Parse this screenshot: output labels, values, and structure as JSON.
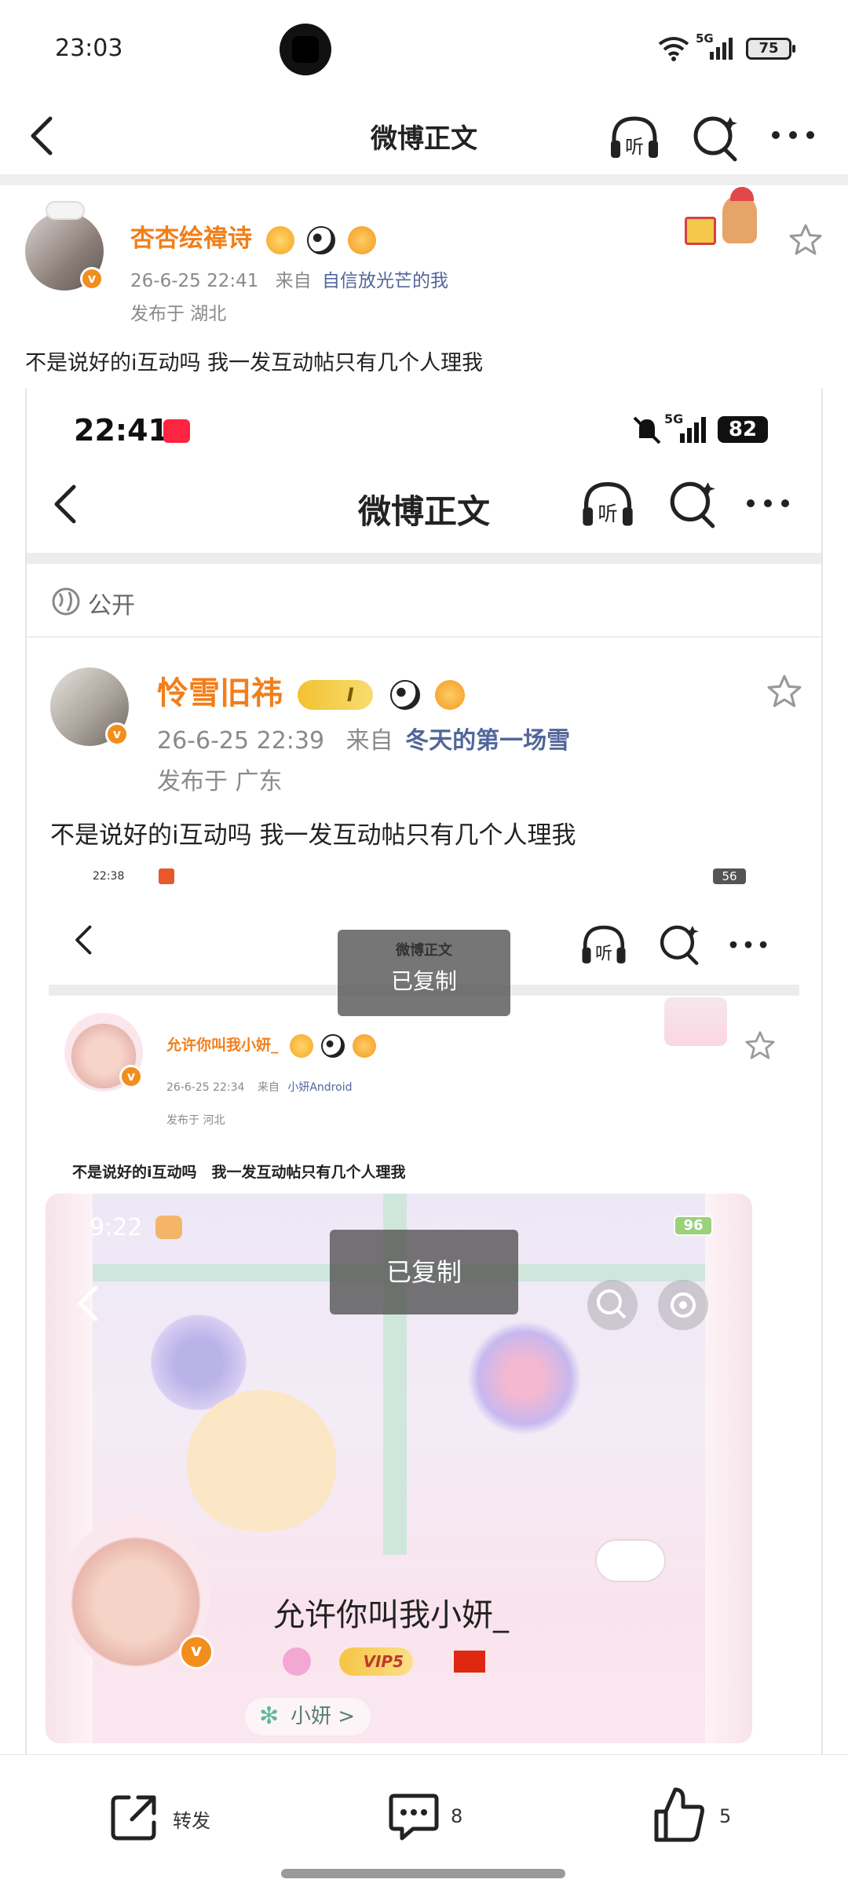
{
  "status_bar": {
    "time": "23:03",
    "battery": "75",
    "network": "5G"
  },
  "nav": {
    "title": "微博正文"
  },
  "post": {
    "author": "杏杏绘禕诗",
    "datetime": "26-6-25 22:41",
    "from_label": "来自",
    "source": "自信放光芒的我",
    "location": "发布于 湖北",
    "text": "不是说好的i互动吗 我一发互动帖只有几个人理我"
  },
  "embedded_1": {
    "status_time": "22:41",
    "battery": "82",
    "network": "5G",
    "nav_title": "微博正文",
    "visibility": "公开",
    "author": "怜雪旧祎",
    "level_badge": "I",
    "datetime": "26-6-25 22:39",
    "from_label": "来自",
    "source": "冬天的第一场雪",
    "location": "发布于 广东",
    "text": "不是说好的i互动吗 我一发互动帖只有几个人理我"
  },
  "embedded_2": {
    "status_time": "22:38",
    "battery": "56",
    "nav_title": "微博正文",
    "toast": "已复制",
    "author": "允许你叫我小妍_",
    "datetime": "26-6-25 22:34",
    "from_label": "来自",
    "source": "小妍Android",
    "location": "发布于 河北",
    "text": "不是说好的i互动吗　我一发互动帖只有几个人理我"
  },
  "embedded_3": {
    "status_time": "9:22",
    "battery": "96",
    "toast": "已复制",
    "profile_name": "允许你叫我小妍_",
    "vip_badge": "VIP5",
    "nickname_tag": "小妍 >"
  },
  "bottom_bar": {
    "repost_label": "转发",
    "comment_count": "8",
    "like_count": "5"
  },
  "icon_names": [
    "back-icon",
    "listen-icon",
    "search-icon",
    "more-icon",
    "star-icon",
    "repost-icon",
    "comment-icon",
    "like-icon"
  ]
}
